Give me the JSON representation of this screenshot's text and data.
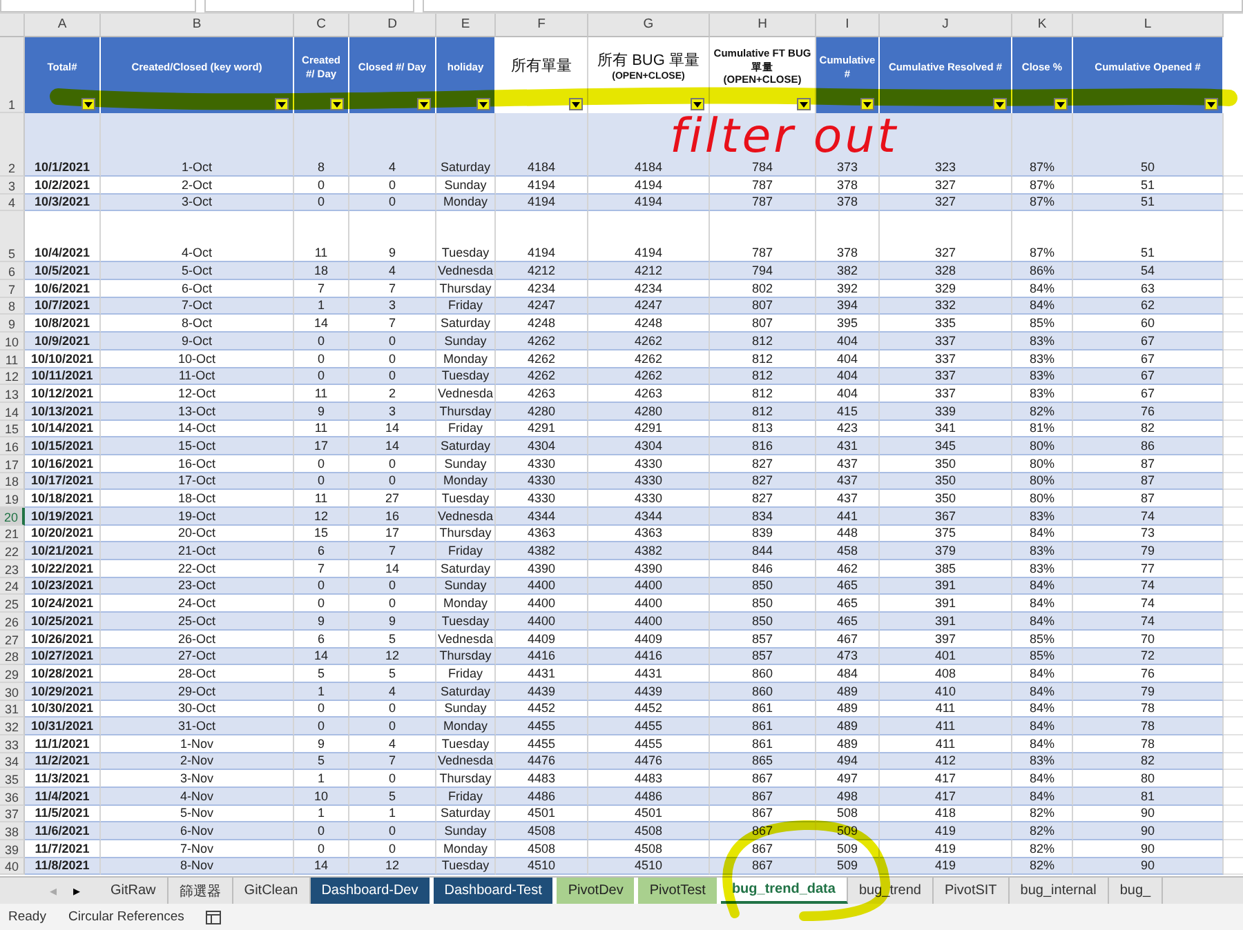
{
  "column_letters": [
    "A",
    "B",
    "C",
    "D",
    "E",
    "F",
    "G",
    "H",
    "I",
    "J",
    "K",
    "L"
  ],
  "header_row_number": "1",
  "header": [
    {
      "label": "Total#",
      "kind": "blue",
      "filter": true
    },
    {
      "label": "Created/Closed (key word)",
      "kind": "blue",
      "filter": true
    },
    {
      "label": "Created #/ Day",
      "kind": "blue",
      "filter": true
    },
    {
      "label": "Closed #/ Day",
      "kind": "blue",
      "filter": true
    },
    {
      "label": "holiday",
      "kind": "blue",
      "filter": true
    },
    {
      "label": "所有單量",
      "kind": "plain",
      "filter": true
    },
    {
      "label": "所有 BUG 單量",
      "note": "(OPEN+CLOSE)",
      "kind": "plain",
      "filter": true
    },
    {
      "label": "Cumulative FT BUG 單量 (OPEN+CLOSE)",
      "kind": "plain",
      "filter": true
    },
    {
      "label": "Cumulative #",
      "kind": "blue",
      "filter": true
    },
    {
      "label": "Cumulative Resolved #",
      "kind": "blue",
      "filter": true
    },
    {
      "label": "Close %",
      "kind": "blue",
      "filter": true
    },
    {
      "label": "Cumulative Opened #",
      "kind": "blue",
      "filter": true
    }
  ],
  "rows": [
    {
      "row_number": "2",
      "tall": true,
      "selected": false,
      "cells": [
        "10/1/2021",
        "1-Oct",
        "8",
        "4",
        "Saturday",
        "4184",
        "4184",
        "784",
        "373",
        "323",
        "87%",
        "50"
      ]
    },
    {
      "row_number": "3",
      "tall": false,
      "selected": false,
      "cells": [
        "10/2/2021",
        "2-Oct",
        "0",
        "0",
        "Sunday",
        "4194",
        "4194",
        "787",
        "378",
        "327",
        "87%",
        "51"
      ]
    },
    {
      "row_number": "4",
      "tall": false,
      "selected": false,
      "cells": [
        "10/3/2021",
        "3-Oct",
        "0",
        "0",
        "Monday",
        "4194",
        "4194",
        "787",
        "378",
        "327",
        "87%",
        "51"
      ]
    },
    {
      "row_number": "5",
      "tall": true,
      "selected": false,
      "cells": [
        "10/4/2021",
        "4-Oct",
        "11",
        "9",
        "Tuesday",
        "4194",
        "4194",
        "787",
        "378",
        "327",
        "87%",
        "51"
      ]
    },
    {
      "row_number": "6",
      "tall": false,
      "selected": false,
      "cells": [
        "10/5/2021",
        "5-Oct",
        "18",
        "4",
        "Vednesda",
        "4212",
        "4212",
        "794",
        "382",
        "328",
        "86%",
        "54"
      ]
    },
    {
      "row_number": "7",
      "tall": false,
      "selected": false,
      "cells": [
        "10/6/2021",
        "6-Oct",
        "7",
        "7",
        "Thursday",
        "4234",
        "4234",
        "802",
        "392",
        "329",
        "84%",
        "63"
      ]
    },
    {
      "row_number": "8",
      "tall": false,
      "selected": false,
      "cells": [
        "10/7/2021",
        "7-Oct",
        "1",
        "3",
        "Friday",
        "4247",
        "4247",
        "807",
        "394",
        "332",
        "84%",
        "62"
      ]
    },
    {
      "row_number": "9",
      "tall": false,
      "selected": false,
      "cells": [
        "10/8/2021",
        "8-Oct",
        "14",
        "7",
        "Saturday",
        "4248",
        "4248",
        "807",
        "395",
        "335",
        "85%",
        "60"
      ]
    },
    {
      "row_number": "10",
      "tall": false,
      "selected": false,
      "cells": [
        "10/9/2021",
        "9-Oct",
        "0",
        "0",
        "Sunday",
        "4262",
        "4262",
        "812",
        "404",
        "337",
        "83%",
        "67"
      ]
    },
    {
      "row_number": "11",
      "tall": false,
      "selected": false,
      "cells": [
        "10/10/2021",
        "10-Oct",
        "0",
        "0",
        "Monday",
        "4262",
        "4262",
        "812",
        "404",
        "337",
        "83%",
        "67"
      ]
    },
    {
      "row_number": "12",
      "tall": false,
      "selected": false,
      "cells": [
        "10/11/2021",
        "11-Oct",
        "0",
        "0",
        "Tuesday",
        "4262",
        "4262",
        "812",
        "404",
        "337",
        "83%",
        "67"
      ]
    },
    {
      "row_number": "13",
      "tall": false,
      "selected": false,
      "cells": [
        "10/12/2021",
        "12-Oct",
        "11",
        "2",
        "Vednesda",
        "4263",
        "4263",
        "812",
        "404",
        "337",
        "83%",
        "67"
      ]
    },
    {
      "row_number": "14",
      "tall": false,
      "selected": false,
      "cells": [
        "10/13/2021",
        "13-Oct",
        "9",
        "3",
        "Thursday",
        "4280",
        "4280",
        "812",
        "415",
        "339",
        "82%",
        "76"
      ]
    },
    {
      "row_number": "15",
      "tall": false,
      "selected": false,
      "cells": [
        "10/14/2021",
        "14-Oct",
        "11",
        "14",
        "Friday",
        "4291",
        "4291",
        "813",
        "423",
        "341",
        "81%",
        "82"
      ]
    },
    {
      "row_number": "16",
      "tall": false,
      "selected": false,
      "cells": [
        "10/15/2021",
        "15-Oct",
        "17",
        "14",
        "Saturday",
        "4304",
        "4304",
        "816",
        "431",
        "345",
        "80%",
        "86"
      ]
    },
    {
      "row_number": "17",
      "tall": false,
      "selected": false,
      "cells": [
        "10/16/2021",
        "16-Oct",
        "0",
        "0",
        "Sunday",
        "4330",
        "4330",
        "827",
        "437",
        "350",
        "80%",
        "87"
      ]
    },
    {
      "row_number": "18",
      "tall": false,
      "selected": false,
      "cells": [
        "10/17/2021",
        "17-Oct",
        "0",
        "0",
        "Monday",
        "4330",
        "4330",
        "827",
        "437",
        "350",
        "80%",
        "87"
      ]
    },
    {
      "row_number": "19",
      "tall": false,
      "selected": false,
      "cells": [
        "10/18/2021",
        "18-Oct",
        "11",
        "27",
        "Tuesday",
        "4330",
        "4330",
        "827",
        "437",
        "350",
        "80%",
        "87"
      ]
    },
    {
      "row_number": "20",
      "tall": false,
      "selected": true,
      "cells": [
        "10/19/2021",
        "19-Oct",
        "12",
        "16",
        "Vednesda",
        "4344",
        "4344",
        "834",
        "441",
        "367",
        "83%",
        "74"
      ]
    },
    {
      "row_number": "21",
      "tall": false,
      "selected": false,
      "cells": [
        "10/20/2021",
        "20-Oct",
        "15",
        "17",
        "Thursday",
        "4363",
        "4363",
        "839",
        "448",
        "375",
        "84%",
        "73"
      ]
    },
    {
      "row_number": "22",
      "tall": false,
      "selected": false,
      "cells": [
        "10/21/2021",
        "21-Oct",
        "6",
        "7",
        "Friday",
        "4382",
        "4382",
        "844",
        "458",
        "379",
        "83%",
        "79"
      ]
    },
    {
      "row_number": "23",
      "tall": false,
      "selected": false,
      "cells": [
        "10/22/2021",
        "22-Oct",
        "7",
        "14",
        "Saturday",
        "4390",
        "4390",
        "846",
        "462",
        "385",
        "83%",
        "77"
      ]
    },
    {
      "row_number": "24",
      "tall": false,
      "selected": false,
      "cells": [
        "10/23/2021",
        "23-Oct",
        "0",
        "0",
        "Sunday",
        "4400",
        "4400",
        "850",
        "465",
        "391",
        "84%",
        "74"
      ]
    },
    {
      "row_number": "25",
      "tall": false,
      "selected": false,
      "cells": [
        "10/24/2021",
        "24-Oct",
        "0",
        "0",
        "Monday",
        "4400",
        "4400",
        "850",
        "465",
        "391",
        "84%",
        "74"
      ]
    },
    {
      "row_number": "26",
      "tall": false,
      "selected": false,
      "cells": [
        "10/25/2021",
        "25-Oct",
        "9",
        "9",
        "Tuesday",
        "4400",
        "4400",
        "850",
        "465",
        "391",
        "84%",
        "74"
      ]
    },
    {
      "row_number": "27",
      "tall": false,
      "selected": false,
      "cells": [
        "10/26/2021",
        "26-Oct",
        "6",
        "5",
        "Vednesda",
        "4409",
        "4409",
        "857",
        "467",
        "397",
        "85%",
        "70"
      ]
    },
    {
      "row_number": "28",
      "tall": false,
      "selected": false,
      "cells": [
        "10/27/2021",
        "27-Oct",
        "14",
        "12",
        "Thursday",
        "4416",
        "4416",
        "857",
        "473",
        "401",
        "85%",
        "72"
      ]
    },
    {
      "row_number": "29",
      "tall": false,
      "selected": false,
      "cells": [
        "10/28/2021",
        "28-Oct",
        "5",
        "5",
        "Friday",
        "4431",
        "4431",
        "860",
        "484",
        "408",
        "84%",
        "76"
      ]
    },
    {
      "row_number": "30",
      "tall": false,
      "selected": false,
      "cells": [
        "10/29/2021",
        "29-Oct",
        "1",
        "4",
        "Saturday",
        "4439",
        "4439",
        "860",
        "489",
        "410",
        "84%",
        "79"
      ]
    },
    {
      "row_number": "31",
      "tall": false,
      "selected": false,
      "cells": [
        "10/30/2021",
        "30-Oct",
        "0",
        "0",
        "Sunday",
        "4452",
        "4452",
        "861",
        "489",
        "411",
        "84%",
        "78"
      ]
    },
    {
      "row_number": "32",
      "tall": false,
      "selected": false,
      "cells": [
        "10/31/2021",
        "31-Oct",
        "0",
        "0",
        "Monday",
        "4455",
        "4455",
        "861",
        "489",
        "411",
        "84%",
        "78"
      ]
    },
    {
      "row_number": "33",
      "tall": false,
      "selected": false,
      "cells": [
        "11/1/2021",
        "1-Nov",
        "9",
        "4",
        "Tuesday",
        "4455",
        "4455",
        "861",
        "489",
        "411",
        "84%",
        "78"
      ]
    },
    {
      "row_number": "34",
      "tall": false,
      "selected": false,
      "cells": [
        "11/2/2021",
        "2-Nov",
        "5",
        "7",
        "Vednesda",
        "4476",
        "4476",
        "865",
        "494",
        "412",
        "83%",
        "82"
      ]
    },
    {
      "row_number": "35",
      "tall": false,
      "selected": false,
      "cells": [
        "11/3/2021",
        "3-Nov",
        "1",
        "0",
        "Thursday",
        "4483",
        "4483",
        "867",
        "497",
        "417",
        "84%",
        "80"
      ]
    },
    {
      "row_number": "36",
      "tall": false,
      "selected": false,
      "cells": [
        "11/4/2021",
        "4-Nov",
        "10",
        "5",
        "Friday",
        "4486",
        "4486",
        "867",
        "498",
        "417",
        "84%",
        "81"
      ]
    },
    {
      "row_number": "37",
      "tall": false,
      "selected": false,
      "cells": [
        "11/5/2021",
        "5-Nov",
        "1",
        "1",
        "Saturday",
        "4501",
        "4501",
        "867",
        "508",
        "418",
        "82%",
        "90"
      ]
    },
    {
      "row_number": "38",
      "tall": false,
      "selected": false,
      "cells": [
        "11/6/2021",
        "6-Nov",
        "0",
        "0",
        "Sunday",
        "4508",
        "4508",
        "867",
        "509",
        "419",
        "82%",
        "90"
      ]
    },
    {
      "row_number": "39",
      "tall": false,
      "selected": false,
      "cells": [
        "11/7/2021",
        "7-Nov",
        "0",
        "0",
        "Monday",
        "4508",
        "4508",
        "867",
        "509",
        "419",
        "82%",
        "90"
      ]
    },
    {
      "row_number": "40",
      "tall": false,
      "selected": false,
      "cells": [
        "11/8/2021",
        "8-Nov",
        "14",
        "12",
        "Tuesday",
        "4510",
        "4510",
        "867",
        "509",
        "419",
        "82%",
        "90"
      ]
    }
  ],
  "sheet_nav": [
    "◂",
    "▸"
  ],
  "sheet_tabs": [
    {
      "label": "GitRaw",
      "selected": false
    },
    {
      "label": "篩選器",
      "selected": false
    },
    {
      "label": "GitClean",
      "selected": false
    },
    {
      "label": "Dashboard-Dev",
      "selected": false,
      "color": "#1f4e79"
    },
    {
      "label": "Dashboard-Test",
      "selected": false,
      "color": "#1f4e79"
    },
    {
      "label": "PivotDev",
      "selected": false,
      "color": "#a9d08e"
    },
    {
      "label": "PivotTest",
      "selected": false,
      "color": "#a9d08e"
    },
    {
      "label": "bug_trend_data",
      "selected": true
    },
    {
      "label": "bug_trend",
      "selected": false
    },
    {
      "label": "PivotSIT",
      "selected": false
    },
    {
      "label": "bug_internal",
      "selected": false
    },
    {
      "label": "bug_",
      "selected": false
    }
  ],
  "status_bar": {
    "items": [
      "Ready",
      "Circular References"
    ]
  },
  "annotations": [
    {
      "kind": "highlight"
    },
    {
      "kind": "text",
      "text": "filter out"
    },
    {
      "kind": "circle"
    }
  ]
}
